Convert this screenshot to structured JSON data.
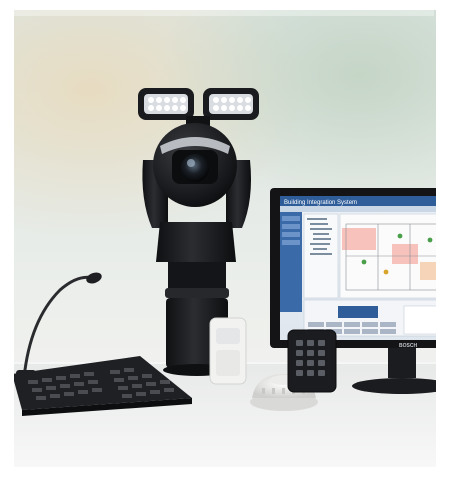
{
  "scene": {
    "monitor": {
      "title_text": "Building Integration System",
      "brand_text": "BOSCH"
    },
    "colors": {
      "background_top": "#dfe7e4",
      "table_surface": "#eef0ef",
      "camera_body": "#1c1d20",
      "monitor_bezel": "#141416",
      "screen_header": "#2f5d9a",
      "screen_bg": "#e9eef3",
      "floorplan_highlight": "#f4a9a0",
      "sensor_white": "#f2f2f0",
      "access_panel": "#1b1c1f"
    }
  }
}
